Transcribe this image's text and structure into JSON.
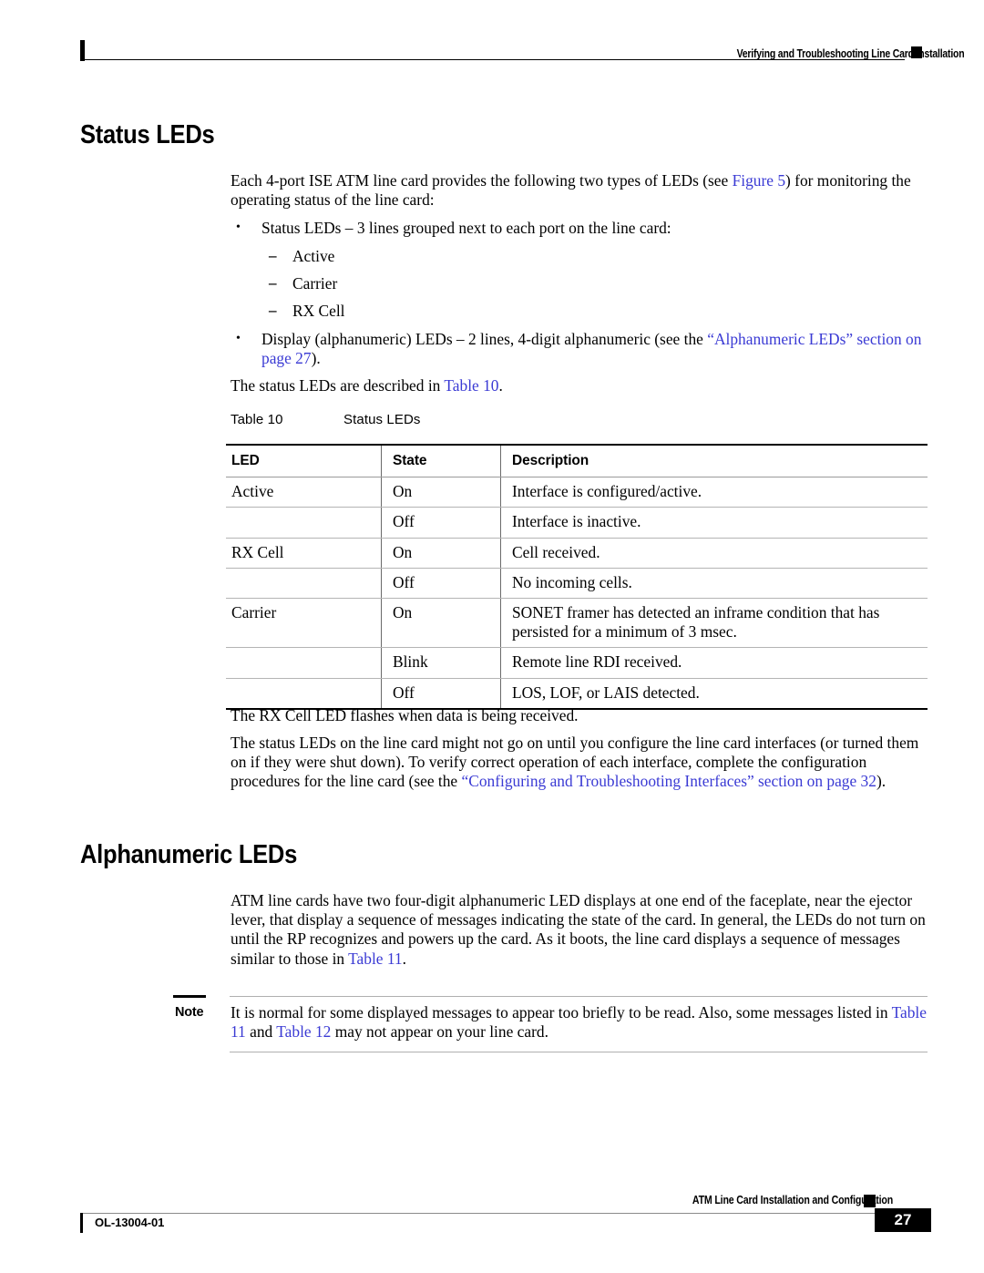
{
  "header": {
    "running_head": "Verifying and Troubleshooting Line Card Installation"
  },
  "sections": [
    {
      "title": "Status LEDs",
      "intro": {
        "pre": "Each 4-port ISE ATM line card provides the following two types of LEDs (see ",
        "link": "Figure 5",
        "post": ") for monitoring the operating status of the line card:"
      }
    },
    {
      "title": "Alphanumeric LEDs"
    }
  ],
  "status_section": {
    "bullets": [
      {
        "text": "Status LEDs – 3 lines grouped next to each port on the line card:"
      }
    ],
    "sub_items": [
      "Active",
      "Carrier",
      "RX Cell"
    ],
    "bullet2": {
      "pre": "Display (alphanumeric) LEDs – 2 lines, 4-digit alphanumeric (see the ",
      "link": "“Alphanumeric LEDs” section on page 27",
      "post": ")."
    },
    "table_ref_sentence": {
      "pre": "The status LEDs are described in ",
      "link": "Table 10",
      "post": "."
    }
  },
  "table": {
    "caption_number": "Table 10",
    "caption_title": "Status LEDs",
    "headers": [
      "LED",
      "State",
      "Description"
    ],
    "rows": [
      {
        "led": "Active",
        "state": "On",
        "description": "Interface is configured/active.",
        "group_start": true
      },
      {
        "led": "",
        "state": "Off",
        "description": "Interface is inactive."
      },
      {
        "led": "RX Cell",
        "state": "On",
        "description": "Cell received.",
        "group_start": true
      },
      {
        "led": "",
        "state": "Off",
        "description": "No incoming cells."
      },
      {
        "led": "Carrier",
        "state": "On",
        "description": "SONET framer has detected an inframe condition that has persisted for a minimum of 3 msec.",
        "group_start": true
      },
      {
        "led": "",
        "state": "Blink",
        "description": "Remote line RDI received."
      },
      {
        "led": "",
        "state": "Off",
        "description": "LOS, LOF, or LAIS detected.",
        "last": true
      }
    ]
  },
  "after_table": {
    "para1": "The RX Cell LED flashes when data is being received.",
    "para2": {
      "pre": "The status LEDs on the line card might not go on until you configure the line card interfaces (or turned them on if they were shut down). To verify correct operation of each interface, complete the configuration procedures for the line card (see the ",
      "link": "“Configuring and Troubleshooting Interfaces” section on page 32",
      "post": ")."
    }
  },
  "alpha_section": {
    "para": {
      "pre": "ATM line cards have two four-digit alphanumeric LED displays at one end of the faceplate, near the ejector lever, that display a sequence of messages indicating the state of the card. In general, the LEDs do not turn on until the RP recognizes and powers up the card. As it boots, the line card displays a sequence of messages similar to those in ",
      "link": "Table 11",
      "post": "."
    }
  },
  "note": {
    "label": "Note",
    "pre": "It is normal for some displayed messages to appear too briefly to be read. Also, some messages listed in ",
    "link1": "Table 11",
    "mid": " and ",
    "link2": "Table 12",
    "post": " may not appear on your line card."
  },
  "footer": {
    "doc_id": "OL-13004-01",
    "title": "ATM Line Card Installation and Configuration",
    "page_number": "27"
  },
  "colors": {
    "link": "#3a3ad4",
    "rule": "#000000"
  }
}
